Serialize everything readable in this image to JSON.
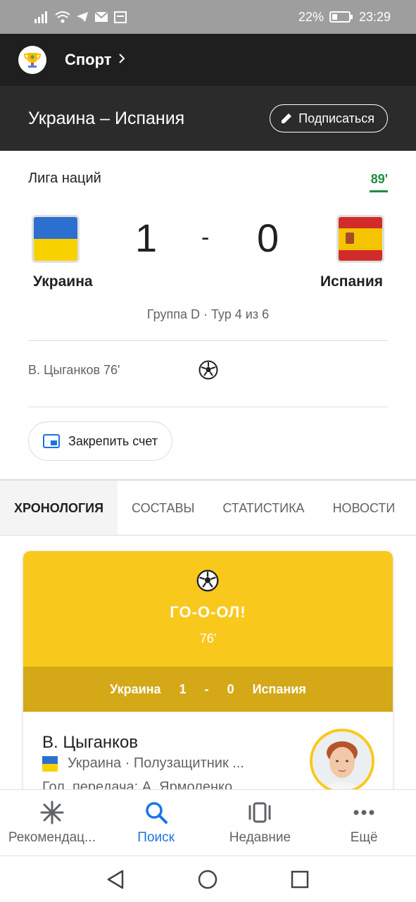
{
  "status_bar": {
    "battery": "22%",
    "time": "23:29"
  },
  "app_header": {
    "title": "Спорт"
  },
  "match_header": {
    "title": "Украина – Испания",
    "subscribe_label": "Подписаться"
  },
  "scorecard": {
    "league": "Лига наций",
    "minute": "89'",
    "home_team": "Украина",
    "away_team": "Испания",
    "home_score": "1",
    "away_score": "0",
    "separator": "-",
    "group_info": "Группа D · Тур 4 из 6",
    "scorer": "В. Цыганков 76'",
    "pin_label": "Закрепить счет"
  },
  "tabs": [
    "ХРОНОЛОГИЯ",
    "СОСТАВЫ",
    "СТАТИСТИКА",
    "НОВОСТИ"
  ],
  "goal_card": {
    "headline": "ГО-О-ОЛ!",
    "minute": "76'",
    "home_team": "Украина",
    "home_score": "1",
    "separator": "-",
    "away_score": "0",
    "away_team": "Испания",
    "player_name": "В. Цыганков",
    "player_info": "Украина · Полузащитник ...",
    "assist_info": "Гол. передача: А. Ярмоленко"
  },
  "bottom_nav": [
    {
      "label": "Рекомендац...",
      "icon": "asterisk-icon"
    },
    {
      "label": "Поиск",
      "icon": "search-icon"
    },
    {
      "label": "Недавние",
      "icon": "recent-icon"
    },
    {
      "label": "Ещё",
      "icon": "more-dots-icon"
    }
  ],
  "colors": {
    "accent": "#1a73e8",
    "live_minute": "#1e8e3e",
    "goal_yellow": "#f9c81c",
    "goal_dark_yellow": "#d4a817",
    "header_dark": "#1f1f1f"
  }
}
